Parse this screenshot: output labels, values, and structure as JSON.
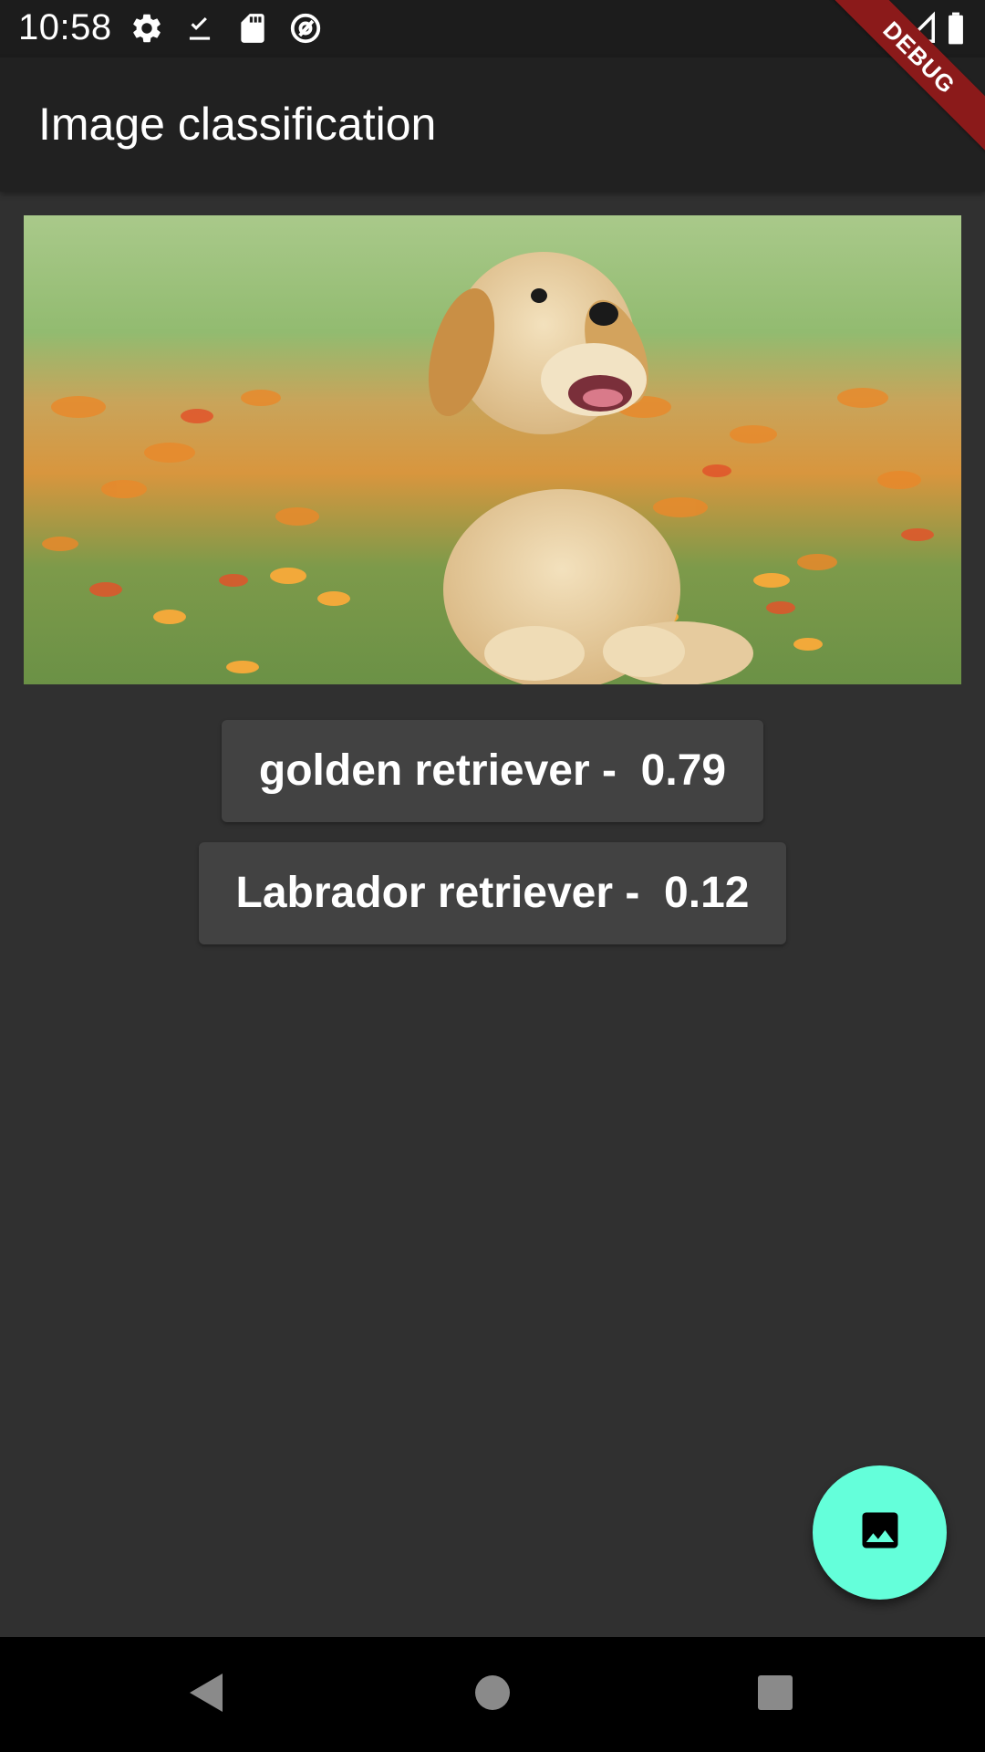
{
  "status_bar": {
    "time": "10:58",
    "icons": [
      "gear-icon",
      "download-done-icon",
      "sd-card-icon",
      "at-sign-icon",
      "wifi-icon",
      "signal-icon",
      "battery-icon"
    ]
  },
  "debug_banner": "DEBUG",
  "app_bar": {
    "title": "Image classification"
  },
  "photo": {
    "subject": "puppy-on-grass-with-flowers"
  },
  "results": [
    {
      "text": "golden retriever -  0.79",
      "label": "golden retriever",
      "confidence": 0.79
    },
    {
      "text": "Labrador retriever -  0.12",
      "label": "Labrador retriever",
      "confidence": 0.12
    }
  ],
  "fab": {
    "icon": "image-icon"
  },
  "nav_bar": {
    "buttons": [
      "back-icon",
      "home-icon",
      "recents-icon"
    ]
  },
  "colors": {
    "background": "#303030",
    "app_bar": "#212121",
    "status_bar": "#1c1c1c",
    "chip": "#424242",
    "fab": "#64ffda",
    "debug_banner": "#8b1a1a"
  }
}
